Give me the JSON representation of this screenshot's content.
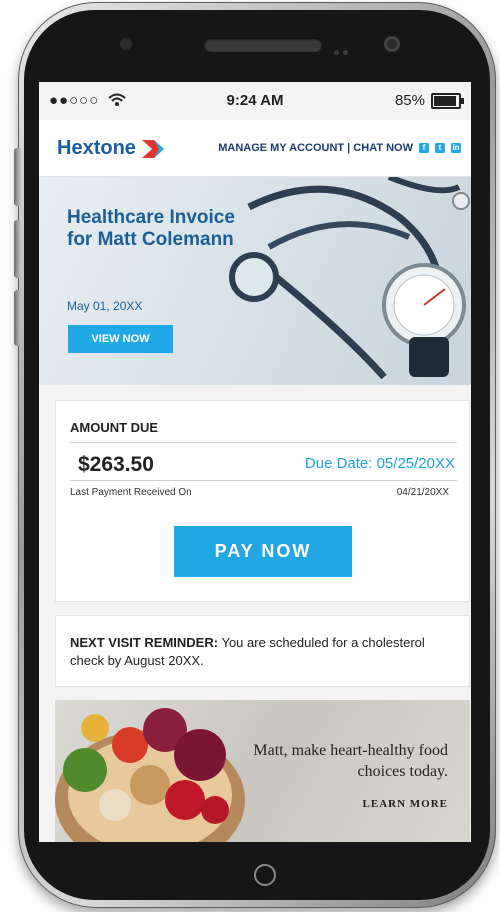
{
  "status_bar": {
    "carrier": "●●○○○",
    "time": "9:24 AM",
    "battery": "85%"
  },
  "header": {
    "logo": "Hextone",
    "nav_text": "MANAGE MY ACCOUNT  |  CHAT NOW",
    "social": [
      "f",
      "t",
      "in"
    ]
  },
  "hero": {
    "title": "Healthcare Invoice for Matt Colemann",
    "date": "May 01, 20XX",
    "button": "VIEW NOW"
  },
  "amount": {
    "label": "AMOUNT DUE",
    "value": "$263.50",
    "due_date": "Due Date: 05/25/20XX",
    "last_payment_label": "Last Payment Received On",
    "last_payment_date": "04/21/20XX",
    "pay_button": "PAY NOW"
  },
  "reminder": {
    "label": "NEXT VISIT REMINDER:",
    "text": "You are scheduled for a cholesterol check by August 20XX."
  },
  "promo": {
    "text": "Matt, make heart-healthy food choices today.",
    "link": "LEARN MORE"
  },
  "colors": {
    "brand_blue": "#1b5e99",
    "accent_cyan": "#23a7e2",
    "logo_red": "#e2352b"
  }
}
